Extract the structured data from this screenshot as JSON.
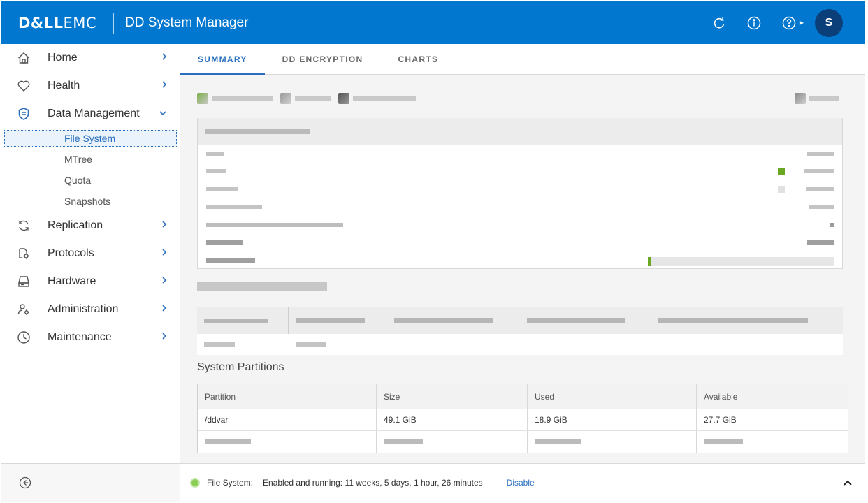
{
  "header": {
    "logo_bold": "D&LL",
    "logo_light": "EMC",
    "title": "DD System Manager",
    "avatar_initial": "S"
  },
  "sidebar": {
    "items": [
      {
        "label": "Home",
        "icon": "home-icon"
      },
      {
        "label": "Health",
        "icon": "heart-icon"
      },
      {
        "label": "Data Management",
        "icon": "shield-icon",
        "expanded": true,
        "sub": [
          "File System",
          "MTree",
          "Quota",
          "Snapshots"
        ]
      },
      {
        "label": "Replication",
        "icon": "sync-icon"
      },
      {
        "label": "Protocols",
        "icon": "protocols-icon"
      },
      {
        "label": "Hardware",
        "icon": "hardware-icon"
      },
      {
        "label": "Administration",
        "icon": "admin-icon"
      },
      {
        "label": "Maintenance",
        "icon": "clock-icon"
      }
    ]
  },
  "tabs": [
    "SUMMARY",
    "DD ENCRYPTION",
    "CHARTS"
  ],
  "partitions": {
    "title": "System Partitions",
    "headers": [
      "Partition",
      "Size",
      "Used",
      "Available"
    ],
    "rows": [
      [
        "/ddvar",
        "49.1 GiB",
        "18.9 GiB",
        "27.7 GiB"
      ]
    ]
  },
  "status": {
    "label": "File System:",
    "value": "Enabled and running: 11 weeks, 5 days, 1 hour, 26 minutes",
    "action": "Disable"
  },
  "colors": {
    "header": "#0277d0",
    "accent": "#2a6fbf",
    "used_swatch": "#6aa723",
    "status_ok": "#8ccf57"
  }
}
